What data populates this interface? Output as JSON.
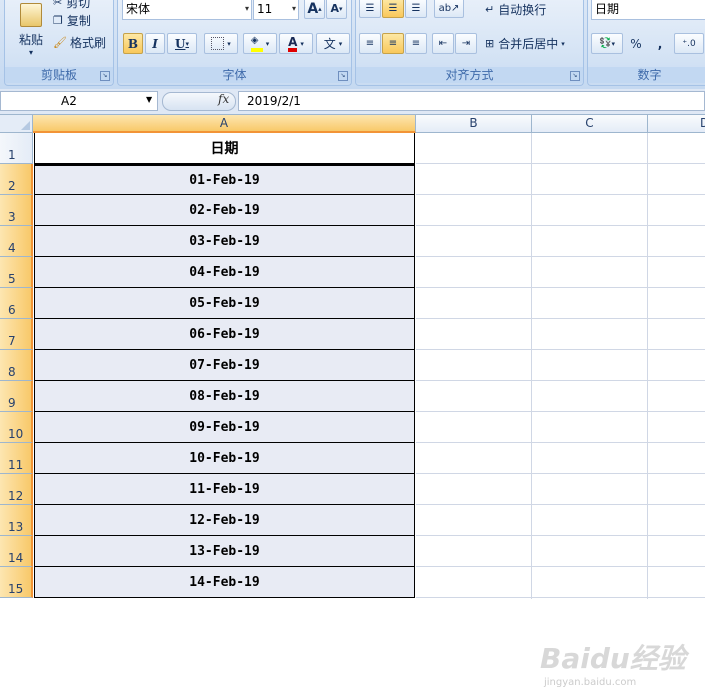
{
  "ribbon": {
    "clipboard": {
      "paste_label": "粘贴",
      "cut_label": "剪切",
      "copy_label": "复制",
      "format_painter_label": "格式刷",
      "group_label": "剪贴板"
    },
    "font": {
      "font_name": "宋体",
      "font_size": "11",
      "bold": "B",
      "italic": "I",
      "underline": "U",
      "grow": "A",
      "shrink": "A",
      "font_color_glyph": "A",
      "phonetic_glyph": "文",
      "group_label": "字体"
    },
    "alignment": {
      "wrap_text_label": "自动换行",
      "merge_center_label": "合并后居中",
      "group_label": "对齐方式"
    },
    "number": {
      "format_value": "日期",
      "percent": "%",
      "comma": ",",
      "group_label": "数字"
    }
  },
  "formula_bar": {
    "name_box": "A2",
    "fx": "fx",
    "formula": "2019/2/1"
  },
  "columns": [
    "A",
    "B",
    "C",
    "D"
  ],
  "rows": [
    "1",
    "2",
    "3",
    "4",
    "5",
    "6",
    "7",
    "8",
    "9",
    "10",
    "11",
    "12",
    "13",
    "14",
    "15"
  ],
  "column_a": [
    "日期",
    "01-Feb-19",
    "02-Feb-19",
    "03-Feb-19",
    "04-Feb-19",
    "05-Feb-19",
    "06-Feb-19",
    "07-Feb-19",
    "08-Feb-19",
    "09-Feb-19",
    "10-Feb-19",
    "11-Feb-19",
    "12-Feb-19",
    "13-Feb-19",
    "14-Feb-19"
  ],
  "watermark": {
    "logo_text": "Baidu经验",
    "url_text": "jingyan.baidu.com"
  },
  "colors": {
    "selection_accent": "#f29436",
    "ribbon_bg": "#d6e4f5",
    "cell_fill": "#e8ebf4"
  }
}
